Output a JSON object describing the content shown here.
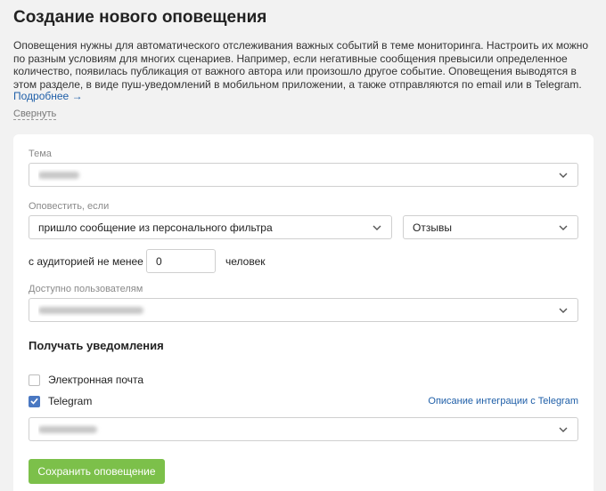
{
  "header": {
    "title": "Создание нового оповещения",
    "intro": "Оповещения нужны для автоматического отслеживания важных событий в теме мониторинга. Настроить их можно по разным условиям для многих сценариев. Например, если негативные сообщения превысили определенное количество, появилась публикация от важного автора или произошло другое событие. Оповещения выводятся в этом разделе, в виде пуш-уведомлений в мобильном приложении, а также отправляются по email или в Telegram.",
    "more_link": "Подробнее →",
    "collapse_link": "Свернуть"
  },
  "form": {
    "topic": {
      "label": "Тема",
      "value": ""
    },
    "notify_if": {
      "label": "Оповестить, если",
      "condition": "пришло сообщение из персонального фильтра",
      "filter": "Отзывы"
    },
    "audience": {
      "prefix": "с аудиторией не менее",
      "value": "0",
      "suffix": "человек"
    },
    "available_to": {
      "label": "Доступно пользователям",
      "value": ""
    },
    "notifications": {
      "title": "Получать уведомления",
      "email": {
        "label": "Электронная почта",
        "checked": false
      },
      "telegram": {
        "label": "Telegram",
        "checked": true
      },
      "integration_link": "Описание интеграции с Telegram",
      "telegram_chat": ""
    },
    "save_label": "Сохранить оповещение"
  },
  "colors": {
    "accent_green": "#7cc04a",
    "link_blue": "#1f5fa8",
    "checkbox_blue": "#4a78c2"
  }
}
